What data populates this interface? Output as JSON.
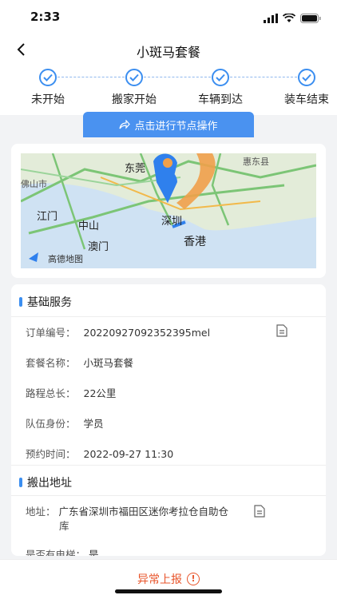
{
  "status": {
    "time": "2:33"
  },
  "header": {
    "title": "小斑马套餐"
  },
  "steps": [
    {
      "label": "未开始"
    },
    {
      "label": "搬家开始"
    },
    {
      "label": "车辆到达"
    },
    {
      "label": "装车结束"
    }
  ],
  "action": {
    "label": "点击进行节点操作"
  },
  "map": {
    "labels": [
      "东莞",
      "惠东县",
      "佛山市",
      "江门",
      "中山",
      "深圳",
      "澳门",
      "香港",
      "高德地图"
    ]
  },
  "basic": {
    "title": "基础服务",
    "rows": [
      {
        "key": "订单编号：",
        "value": "20220927092352395mel"
      },
      {
        "key": "套餐名称：",
        "value": "小斑马套餐"
      },
      {
        "key": "路程总长：",
        "value": "22公里"
      },
      {
        "key": "队伍身份：",
        "value": "学员"
      },
      {
        "key": "预约时间：",
        "value": "2022-09-27 11:30"
      }
    ]
  },
  "moveout": {
    "title": "搬出地址",
    "address_key": "地址：",
    "address_line1": "广东省深圳市福田区迷你考拉仓自助仓",
    "address_line2": "库",
    "elevator_key": "是否有电梯：",
    "elevator_value": "是"
  },
  "bottom": {
    "report_label": "异常上报"
  },
  "colors": {
    "accent": "#3b8ef0",
    "warning": "#e8552b"
  }
}
